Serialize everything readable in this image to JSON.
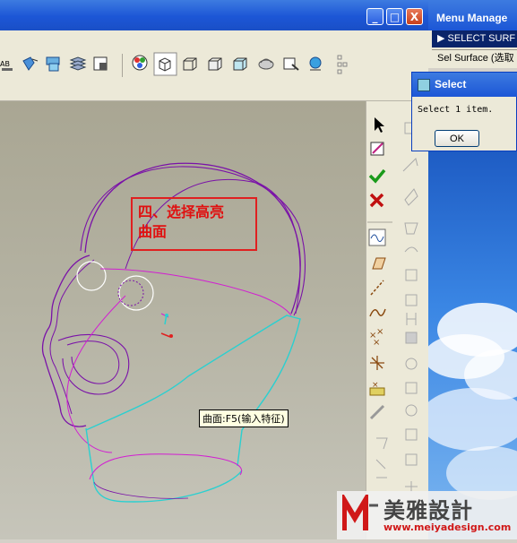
{
  "main_window": {
    "buttons": {
      "minimize": "_",
      "maximize": "□",
      "close": "X"
    }
  },
  "annotation": {
    "line1": "四、选择高亮",
    "line2": "曲面",
    "color": "#e02020"
  },
  "tooltip": {
    "text": "曲面:F5(输入特征)"
  },
  "menu_manager": {
    "title": "Menu Manage",
    "selected_item": "SELECT SURF",
    "item": "Sel Surface (选取"
  },
  "select_dialog": {
    "title": "Select",
    "message": "Select 1 item.",
    "ok_label": "OK"
  },
  "watermark": {
    "brand": "美雅設計",
    "url": "www.meiyadesign.com"
  },
  "colors": {
    "curve_purple": "#7a12a8",
    "curve_magenta": "#d21ed2",
    "curve_cyan": "#2ad0d0",
    "titlebar_blue": "#1c56d6"
  },
  "icons": {
    "top_toolbar": [
      "text-ab-icon",
      "rotate-view-icon",
      "regen-icon",
      "layer-icon",
      "model-tree-icon",
      "color-appearance-icon",
      "shaded-cube-icon",
      "wireframe-icon",
      "hidden-line-icon",
      "no-hidden-icon",
      "shading-icon",
      "saved-views-icon",
      "spin-center-icon",
      "datum-icon"
    ],
    "right_toolbar": [
      "pointer-icon",
      "sketch-icon",
      "accept-icon",
      "cancel-icon",
      "curve-icon",
      "plane-icon",
      "axis-icon",
      "spline-icon",
      "points-icon",
      "csys-icon",
      "analysis-icon",
      "offset-icon"
    ]
  }
}
